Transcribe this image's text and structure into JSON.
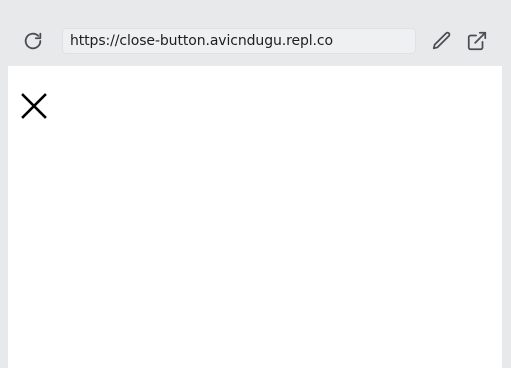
{
  "browser": {
    "url": "https://close-button.avicndugu.repl.co",
    "icons": {
      "reload": "reload-icon",
      "edit": "pencil-icon",
      "open_new_tab": "external-link-icon"
    }
  },
  "page": {
    "close_button": {
      "icon": "close-icon",
      "color": "#000000"
    }
  }
}
